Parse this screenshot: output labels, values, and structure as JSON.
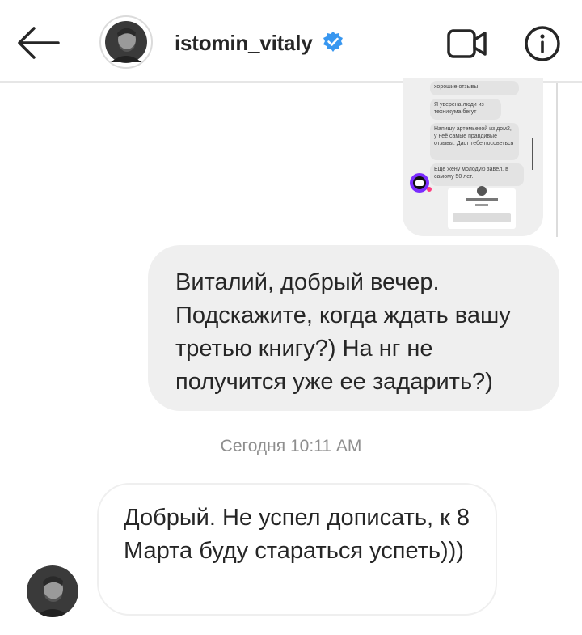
{
  "header": {
    "username": "istomin_vitaly",
    "verified": true,
    "back_icon": "arrow-left-icon",
    "video_icon": "video-camera-icon",
    "info_icon": "info-icon"
  },
  "shared_post": {
    "lines": [
      "хорошие отзывы",
      "Я уверена люди из техникума бегут",
      "Напишу артемьевой из дом2, у неё самые правдивые отзывы. Даст тебе посоветься",
      "Ещё жену молодую завёл, в самому 50 лет."
    ]
  },
  "messages": [
    {
      "direction": "outgoing",
      "text": "Виталий, добрый вечер. Подскажите, когда ждать вашу третью книгу?) На нг не получится уже ее задарить?)"
    },
    {
      "direction": "incoming",
      "text": "Добрый. Не успел дописать, к 8 Марта буду стараться успеть)))"
    }
  ],
  "timestamp": "Сегодня 10:11 AM",
  "colors": {
    "bubble_gray": "#efefef",
    "verified_blue": "#3897f0",
    "text": "#262626",
    "timestamp": "#8e8e8e"
  }
}
